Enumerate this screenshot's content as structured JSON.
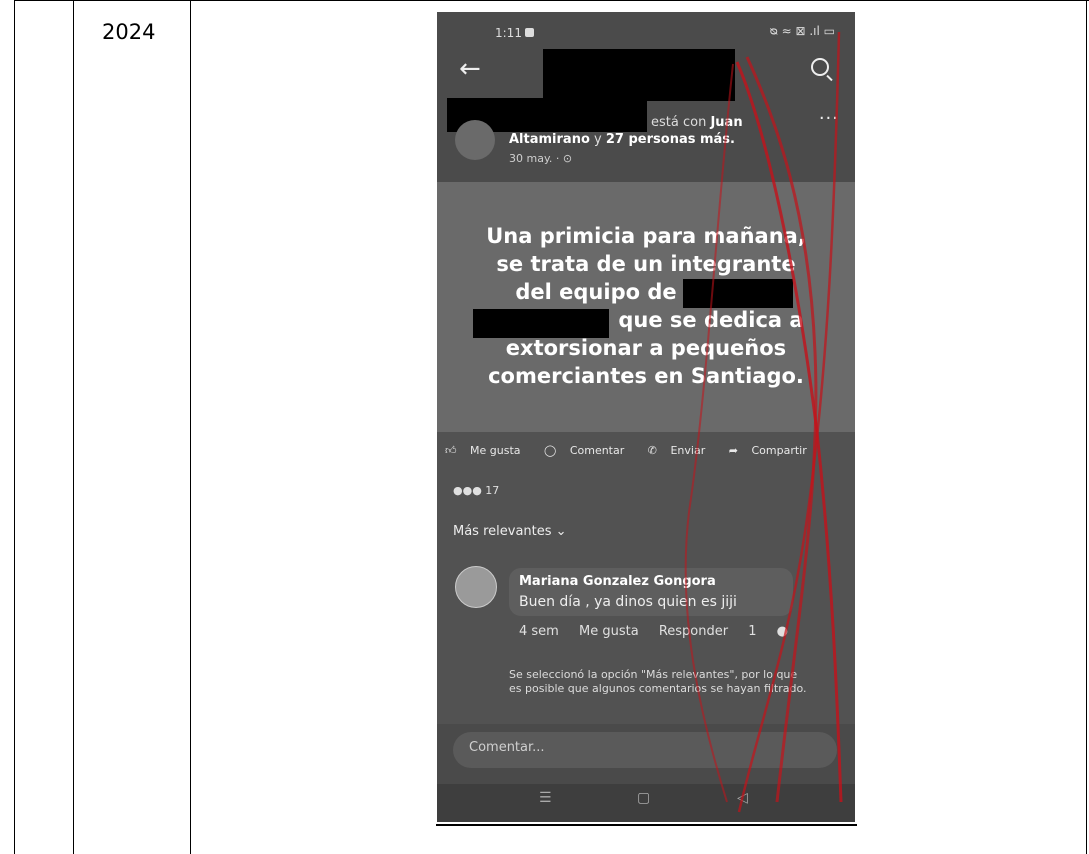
{
  "table": {
    "year": "2024"
  },
  "phone": {
    "status": {
      "time": "1:11",
      "icons": "ᴓ ≈ ⊠ .ıl ▭"
    },
    "post": {
      "with_text": "está con",
      "tagged_name": "Juan",
      "tagged_rest_name": "Altamirano",
      "tagged_join": "y",
      "tagged_others": "27 personas más.",
      "date": "30 may. · ⊙",
      "line1": "Una primicia para mañana,",
      "line2": "se trata de un integrante",
      "line3": "del equipo de",
      "line4": "que se dedica a",
      "line5": "extorsionar a pequeños",
      "line6": "comerciantes en Santiago."
    },
    "actions": {
      "like": "Me gusta",
      "comment": "Comentar",
      "send": "Enviar",
      "share": "Compartir"
    },
    "reactions_count": "17",
    "filter_label": "Más relevantes",
    "comment": {
      "author": "Mariana Gonzalez Gongora",
      "text": "Buen día , ya dinos quien es jiji",
      "age": "4 sem",
      "like": "Me gusta",
      "reply": "Responder",
      "likes": "1"
    },
    "filter_note": "Se seleccionó la opción \"Más relevantes\", por lo que es posible que algunos comentarios se hayan filtrado.",
    "input_placeholder": "Comentar..."
  }
}
